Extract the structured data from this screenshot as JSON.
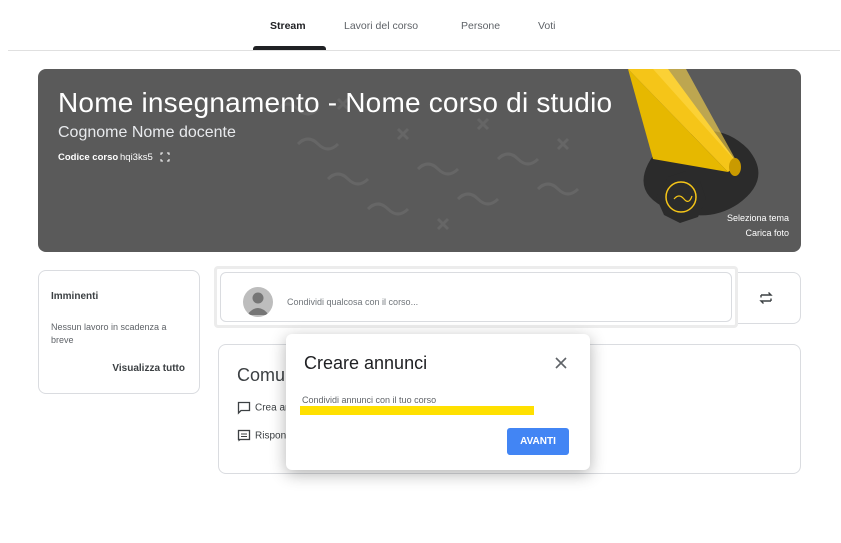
{
  "nav": {
    "tabs": [
      {
        "label": "Stream",
        "active": true
      },
      {
        "label": "Lavori del corso",
        "active": false
      },
      {
        "label": "Persone",
        "active": false
      },
      {
        "label": "Voti",
        "active": false
      }
    ]
  },
  "banner": {
    "title": "Nome insegnamento - Nome corso di studio",
    "teacher": "Cognome Nome docente",
    "code_label": "Codice corso",
    "code": "hqi3ks5",
    "select_theme": "Seleziona tema",
    "upload_photo": "Carica foto",
    "background_color": "#5a5a5a",
    "accent_color": "#f5c518"
  },
  "upcoming": {
    "title": "Imminenti",
    "text": "Nessun lavoro in scadenza a breve",
    "link": "Visualizza tutto"
  },
  "share": {
    "placeholder": "Condividi qualcosa con il corso..."
  },
  "communicate": {
    "title": "Comunica",
    "row1": "Crea annuncio",
    "row2": "Rispondi"
  },
  "dialog": {
    "title": "Creare annunci",
    "text": "Condividi annunci con il tuo corso",
    "button": "AVANTI",
    "button_color": "#4285f4",
    "highlight_color": "#ffe000"
  },
  "icons": {
    "fullscreen": "fullscreen-icon",
    "avatar": "avatar-icon",
    "repost": "repost-icon",
    "close": "close-icon",
    "comment": "comment-icon",
    "reply": "reply-icon"
  }
}
